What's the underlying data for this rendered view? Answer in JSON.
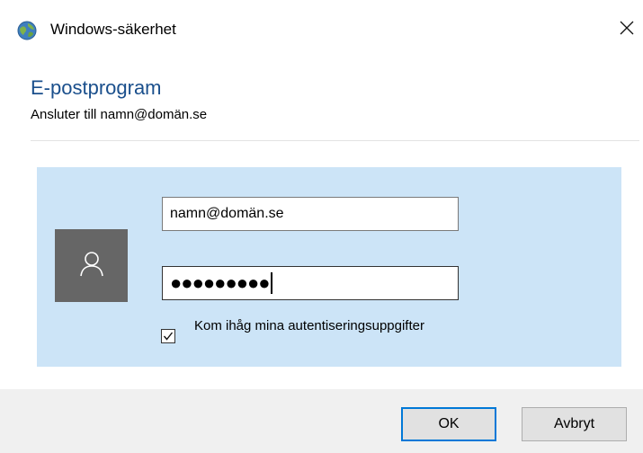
{
  "window": {
    "title": "Windows-säkerhet",
    "icon": "windows-security-globe-icon",
    "close_icon": "close-icon"
  },
  "dialog": {
    "heading": "E-postprogram",
    "subheading": "Ansluter till namn@domän.se",
    "accent_color": "#1a4f8c"
  },
  "credential": {
    "tile_color": "#cce4f7",
    "avatar_icon": "user-icon",
    "username_value": "namn@domän.se",
    "password_mask": "●●●●●●●●●",
    "remember": {
      "checked": true,
      "label": "Kom ihåg mina autentiseringsuppgifter"
    }
  },
  "buttons": {
    "ok_label": "OK",
    "cancel_label": "Avbryt",
    "default_border_color": "#0078d7"
  }
}
